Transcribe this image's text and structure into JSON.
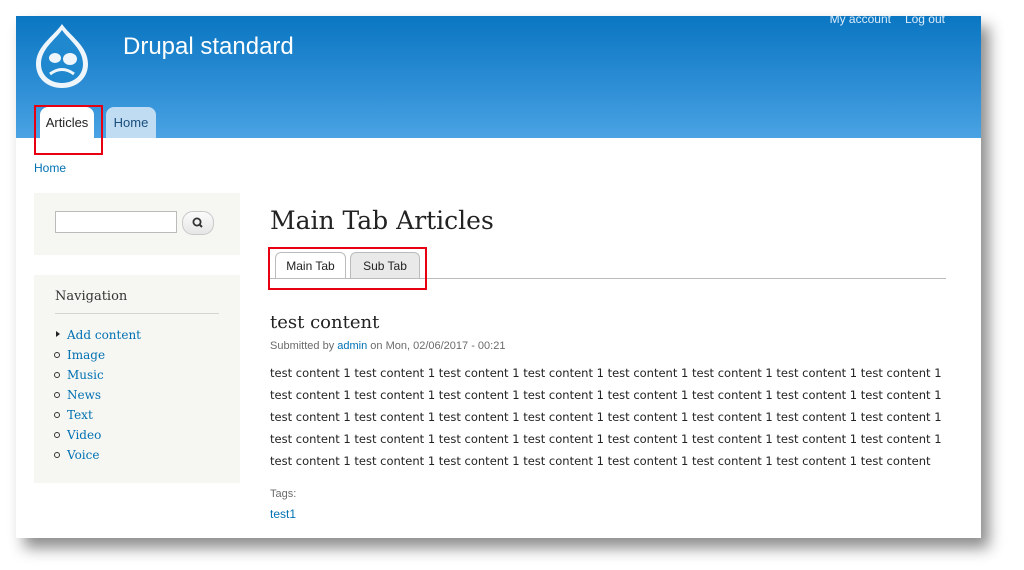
{
  "header": {
    "site_name": "Drupal standard",
    "secondary_menu": [
      "My account",
      "Log out"
    ],
    "tabs": [
      {
        "label": "Articles",
        "active": true
      },
      {
        "label": "Home",
        "active": false
      }
    ],
    "logo_icon": "drupal-drop-icon"
  },
  "breadcrumb": "Home",
  "sidebar": {
    "search_icon": "search-icon",
    "navigation": {
      "title": "Navigation",
      "items": [
        "Add content",
        "Image",
        "Music",
        "News",
        "Text",
        "Video",
        "Voice"
      ]
    }
  },
  "main": {
    "title": "Main Tab Articles",
    "tabs": [
      {
        "label": "Main Tab",
        "active": true
      },
      {
        "label": "Sub Tab",
        "active": false
      }
    ],
    "node": {
      "title": "test content",
      "submitted_prefix": "Submitted by",
      "author": "admin",
      "submitted_suffix": "on Mon, 02/06/2017 - 00:21",
      "body_lines": [
        "test content 1 test content 1 test content 1 test content 1 test content 1 test content 1 test content 1 test content 1",
        "test content 1 test content 1 test content 1 test content 1 test content 1 test content 1 test content 1 test content 1",
        "test content 1 test content 1 test content 1 test content 1 test content 1 test content 1 test content 1 test content 1",
        "test content 1 test content 1 test content 1 test content 1 test content 1 test content 1 test content 1 test content 1",
        "test content 1 test content 1 test content 1 test content 1 test content 1 test content 1 test content 1 test content"
      ],
      "tags_label": "Tags:",
      "tags": [
        "test1"
      ]
    }
  },
  "colors": {
    "highlight": "#e60012",
    "link": "#0071b3",
    "header": "#0a76c2"
  }
}
